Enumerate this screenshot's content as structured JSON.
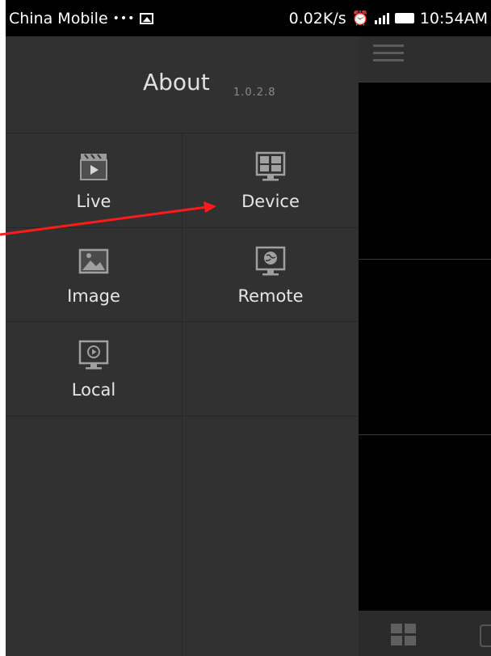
{
  "status_bar": {
    "carrier": "China Mobile",
    "dots": "•••",
    "speed": "0.02K/s",
    "time": "10:54AM",
    "icons": [
      "image-icon",
      "alarm-icon",
      "signal-icon",
      "battery-icon"
    ]
  },
  "drawer": {
    "about_label": "About",
    "version": "1.0.2.8",
    "menu_items": [
      {
        "label": "Live",
        "icon": "clapper-icon"
      },
      {
        "label": "Device",
        "icon": "monitor-grid-icon"
      },
      {
        "label": "Image",
        "icon": "picture-icon"
      },
      {
        "label": "Remote",
        "icon": "remote-monitor-icon"
      },
      {
        "label": "Local",
        "icon": "local-video-icon"
      }
    ]
  },
  "right_panel": {
    "top_icon": "menu-icon",
    "bottom_icons": [
      "grid-view-icon",
      "partial-icon"
    ]
  },
  "annotation": {
    "color": "#ff1a1a",
    "target": "Device"
  },
  "colors": {
    "drawer_bg": "#313131",
    "status_bg": "#000000",
    "accent_text": "#e6e6e6"
  }
}
